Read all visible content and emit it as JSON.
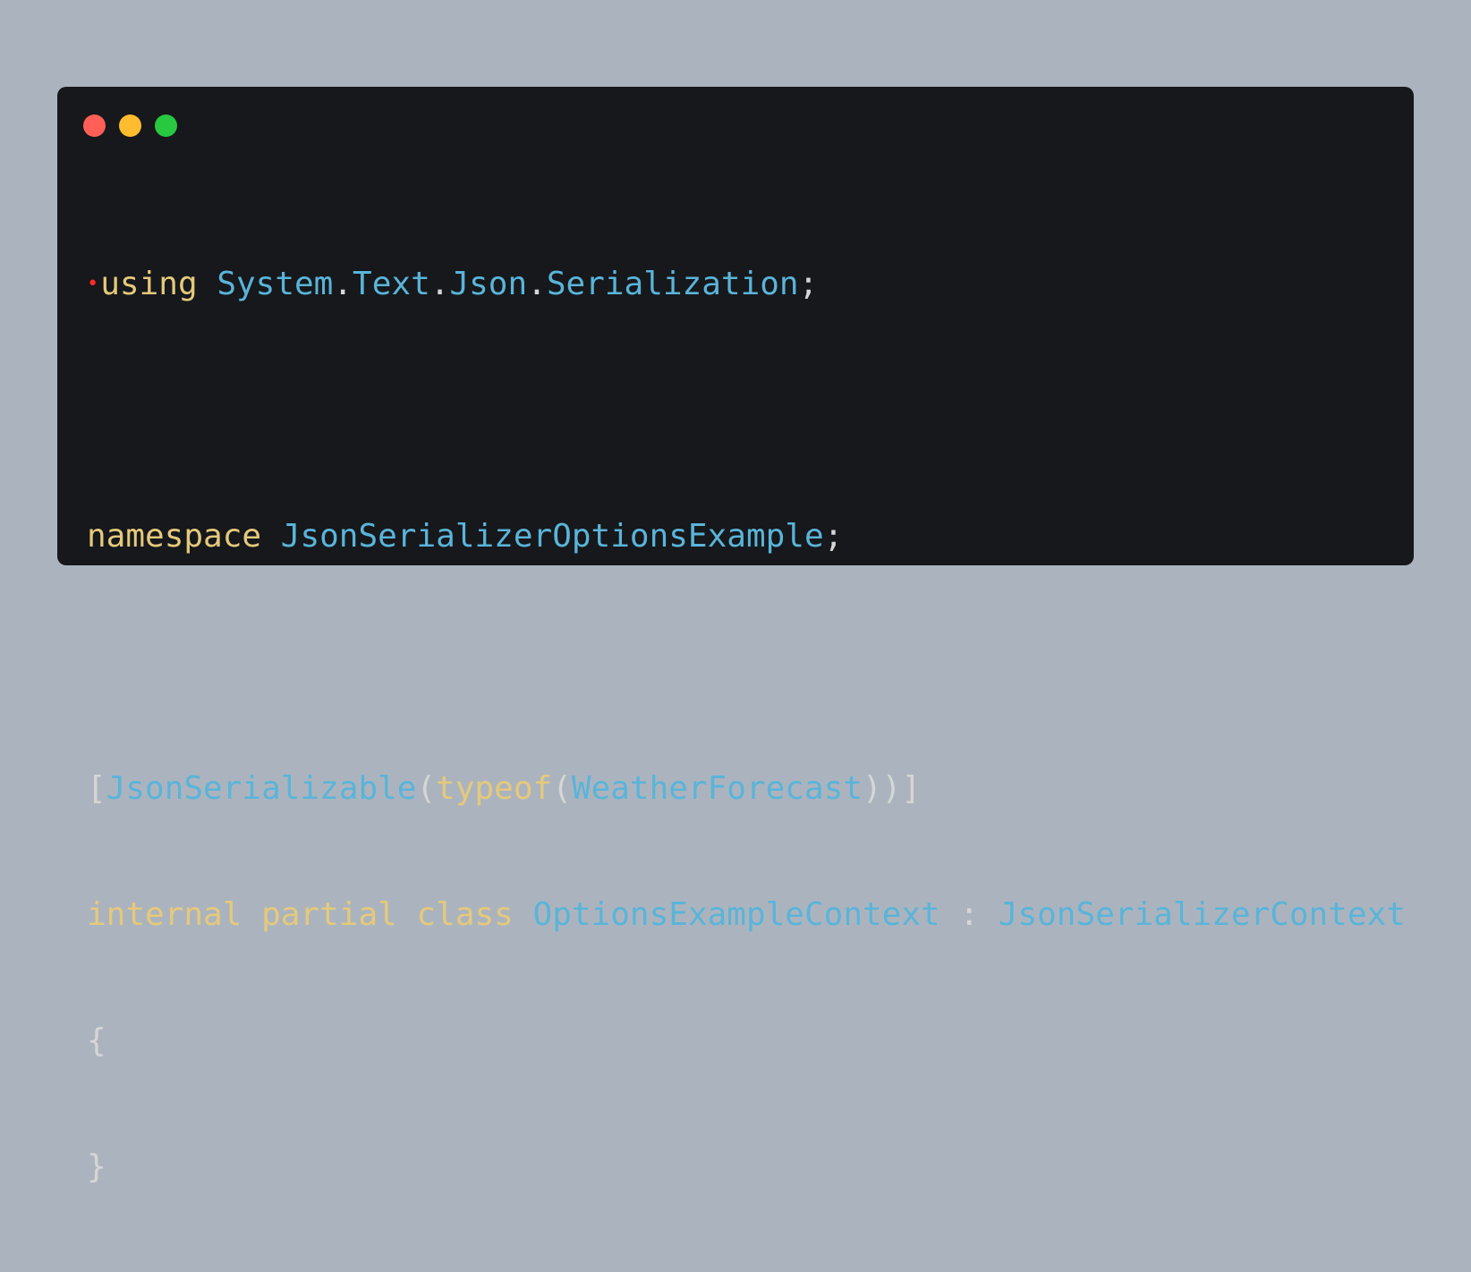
{
  "colors": {
    "background": "#abb4be",
    "editor_bg": "#16181b",
    "keyword": "#e5c97b",
    "type": "#5ab4d9",
    "punctuation": "#d6d6d6",
    "marker": "#ff2b2b",
    "traffic_red": "#ff5f57",
    "traffic_yellow": "#febc2e",
    "traffic_green": "#28c840"
  },
  "code": {
    "line1": {
      "marker": "•",
      "kw_using": "using",
      "ns_system": "System",
      "dot1": ".",
      "ns_text": "Text",
      "dot2": ".",
      "ns_json": "Json",
      "dot3": ".",
      "ns_serialization": "Serialization",
      "semi": ";"
    },
    "line2": {
      "kw_namespace": "namespace",
      "ns_name": "JsonSerializerOptionsExample",
      "semi": ";"
    },
    "line3": {
      "open_bracket": "[",
      "attr": "JsonSerializable",
      "open_paren1": "(",
      "kw_typeof": "typeof",
      "open_paren2": "(",
      "type_arg": "WeatherForecast",
      "close": "))]"
    },
    "line4": {
      "kw_internal": "internal",
      "kw_partial": "partial",
      "kw_class": "class",
      "class_name": "OptionsExampleContext",
      "colon": ":",
      "base_class": "JsonSerializerContext"
    },
    "line5": {
      "brace": "{"
    },
    "line6": {
      "brace": "}"
    }
  }
}
